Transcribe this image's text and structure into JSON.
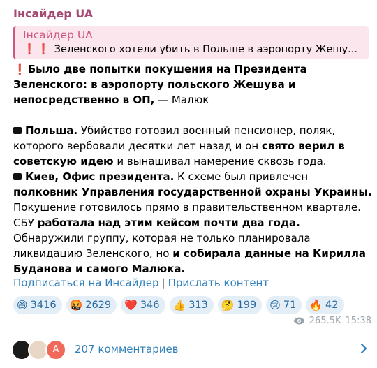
{
  "channel": {
    "name": "Інсайдер UA"
  },
  "reply": {
    "name": "Інсайдер UA",
    "text": "Зеленского хотели убить в Польше в аэропорту Жешу..."
  },
  "post": {
    "p1_bold": "Было две попытки покушения на Президента Зеленского: в аэропорту польского Жешува и непосредственно в ОП,",
    "p1_rest": " — Малюк",
    "p2_bold1": "Польша.",
    "p2_t1": " Убийство готовил военный пенсионер, поляк, которого вербовали десятки лет назад и он ",
    "p2_bold2": "свято верил в советскую идею",
    "p2_t2": " и вынашивал намерение сквозь года.",
    "p3_bold1": "Киев, Офис президента.",
    "p3_t1": " К схеме был привлечен ",
    "p3_bold2": "полковник Управления государственной охраны Украины.",
    "p3_t2": " Покушение готовилось прямо в правительственном квартале. СБУ ",
    "p3_bold3": "работала над этим кейсом почти два года.",
    "p3_t3": " Обнаружили группу, которая не только планировала ликвидацию Зеленского, но ",
    "p3_bold4": "и собирала данные на Кирилла Буданова и самого Малюка."
  },
  "links": {
    "subscribe": "Подписаться на Инсайдер",
    "separator": "|",
    "send": "Прислать контент"
  },
  "reactions": [
    {
      "emoji": "😄",
      "count": "3416"
    },
    {
      "emoji": "🤬",
      "count": "2629"
    },
    {
      "emoji": "❤️",
      "count": "346"
    },
    {
      "emoji": "👍",
      "count": "313"
    },
    {
      "emoji": "🤔",
      "count": "199"
    },
    {
      "emoji": "😢",
      "count": "71"
    },
    {
      "emoji": "🔥",
      "count": "42"
    }
  ],
  "meta": {
    "views": "265.5K",
    "time": "15:38"
  },
  "comments": {
    "label": "207 комментариев",
    "avatar_letter": "A"
  },
  "colors": {
    "channel": "#a54872",
    "reply_bg": "#fbe6ee",
    "link": "#2f7fb8",
    "reaction_bg": "#e4eef6"
  }
}
